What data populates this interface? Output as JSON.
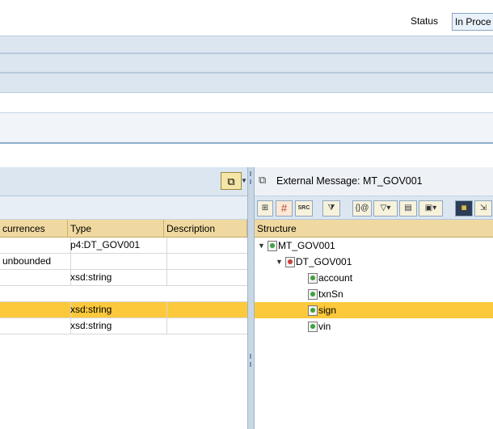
{
  "header": {
    "status_label": "Status",
    "status_value": "In Proce"
  },
  "left_table": {
    "columns": [
      "currences",
      "Type",
      "Description"
    ],
    "rows": [
      {
        "occurrences": "",
        "type": "p4:DT_GOV001",
        "description": "",
        "selected": false
      },
      {
        "occurrences": "unbounded",
        "type": "",
        "description": "",
        "selected": false
      },
      {
        "occurrences": "",
        "type": "xsd:string",
        "description": "",
        "selected": false
      },
      {
        "occurrences": "",
        "type": "xsd:string",
        "description": "",
        "selected": true
      },
      {
        "occurrences": "",
        "type": "xsd:string",
        "description": "",
        "selected": false
      }
    ]
  },
  "right_panel": {
    "title": "External Message: MT_GOV001",
    "structure_header": "Structure",
    "tree": [
      {
        "label": "MT_GOV001",
        "level": 0,
        "expanded": true,
        "kind": "message",
        "selected": false
      },
      {
        "label": "DT_GOV001",
        "level": 1,
        "expanded": true,
        "kind": "complex",
        "selected": false
      },
      {
        "label": "account",
        "level": 2,
        "kind": "element",
        "selected": false
      },
      {
        "label": "txnSn",
        "level": 2,
        "kind": "element",
        "selected": false
      },
      {
        "label": "sign",
        "level": 2,
        "kind": "element",
        "selected": true
      },
      {
        "label": "vin",
        "level": 2,
        "kind": "element",
        "selected": false
      }
    ],
    "toolbar_icons": [
      "tree-view-icon",
      "grid-view-icon",
      "source-view-icon",
      "filter-icon",
      "where-used-icon",
      "find-icon",
      "properties-icon",
      "export-icon",
      "binoculars-icon",
      "find-next-icon"
    ]
  },
  "colors": {
    "selection": "#fcc93c",
    "column_header": "#f0d9a0",
    "band_blue": "#dbe6f1"
  }
}
